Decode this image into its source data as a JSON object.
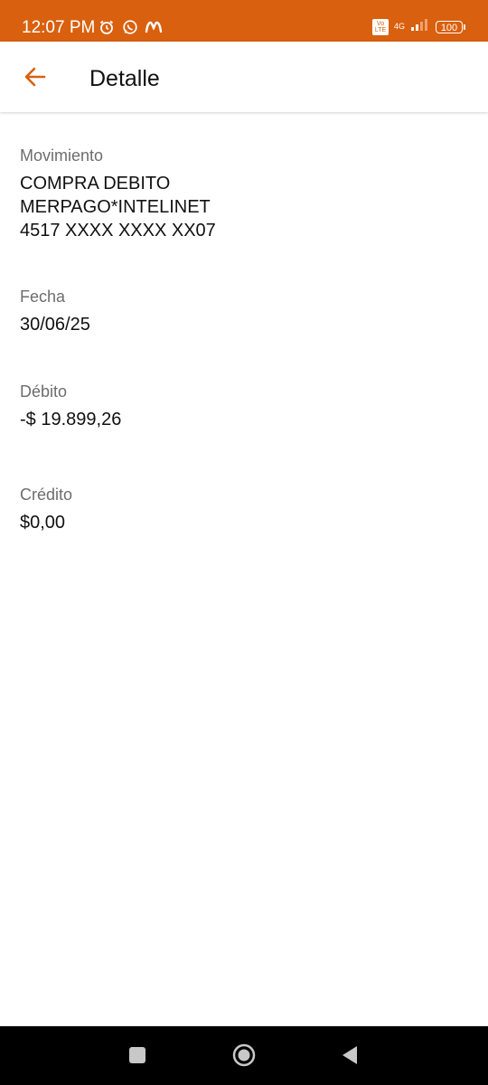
{
  "status_bar": {
    "time": "12:07 PM",
    "left_icons": [
      "alarm-icon",
      "whatsapp-icon",
      "movistar-icon"
    ],
    "network_badge": "Vo LTE",
    "network_type": "4G",
    "battery": "100"
  },
  "app_bar": {
    "title": "Detalle",
    "back_icon": "arrow-left-icon"
  },
  "details": {
    "movimiento": {
      "label": "Movimiento",
      "line1": "COMPRA DEBITO",
      "line2": "MERPAGO*INTELINET",
      "line3": "4517 XXXX XXXX XX07"
    },
    "fecha": {
      "label": "Fecha",
      "value": "30/06/25"
    },
    "debito": {
      "label": "Débito",
      "value": "-$ 19.899,26"
    },
    "credito": {
      "label": "Crédito",
      "value": "$0,00"
    }
  },
  "nav_bar": {
    "buttons": [
      "recents-square-icon",
      "home-circle-icon",
      "back-triangle-icon"
    ]
  },
  "colors": {
    "accent": "#d9600e",
    "text_primary": "#111111",
    "text_secondary": "#6d6d6d"
  }
}
